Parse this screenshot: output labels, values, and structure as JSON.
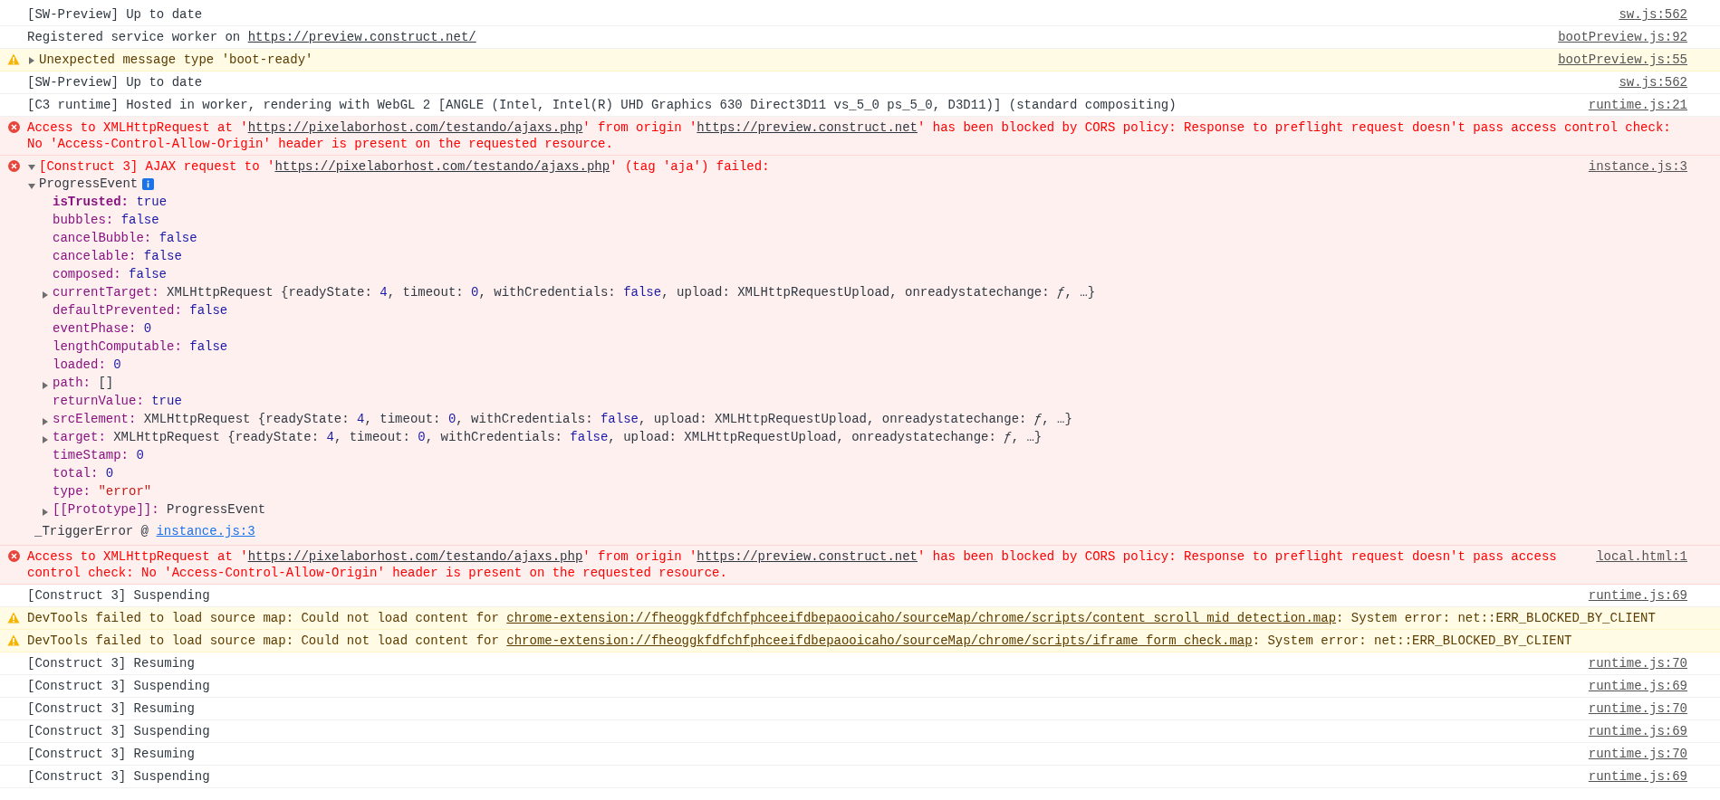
{
  "console": {
    "messages": [
      {
        "kind": "info",
        "parts": [
          {
            "text": "[SW-Preview] Up to date"
          }
        ],
        "source": "sw.js:562"
      },
      {
        "kind": "info",
        "parts": [
          {
            "text": "Registered service worker on "
          },
          {
            "link": "https://preview.construct.net/"
          }
        ],
        "source": "bootPreview.js:92"
      },
      {
        "kind": "warning",
        "expandable": true,
        "expanded": false,
        "parts": [
          {
            "text": "Unexpected message type 'boot-ready'"
          }
        ],
        "source": "bootPreview.js:55"
      },
      {
        "kind": "info",
        "parts": [
          {
            "text": "[SW-Preview] Up to date"
          }
        ],
        "source": "sw.js:562"
      },
      {
        "kind": "info",
        "parts": [
          {
            "text": "[C3 runtime] Hosted in worker, rendering with WebGL 2 [ANGLE (Intel, Intel(R) UHD Graphics 630 Direct3D11 vs_5_0 ps_5_0, D3D11)] (standard compositing)"
          }
        ],
        "source": "runtime.js:21"
      },
      {
        "kind": "error",
        "parts": [
          {
            "text": "Access to XMLHttpRequest at '"
          },
          {
            "link": "https://pixelaborhost.com/testando/ajaxs.php"
          },
          {
            "text": "' from origin '"
          },
          {
            "link": "https://preview.construct.net"
          },
          {
            "text": "' has been blocked by CORS policy: Response to preflight request doesn't pass access control check: No 'Access-Control-Allow-Origin' header is present on the requested resource."
          }
        ]
      },
      {
        "kind": "error",
        "expandable": true,
        "expanded": true,
        "parts": [
          {
            "text": "[Construct 3] AJAX request to '"
          },
          {
            "link": "https://pixelaborhost.com/testando/ajaxs.php"
          },
          {
            "text": "' (tag 'aja') failed:"
          }
        ],
        "source": "instance.js:3",
        "object": {
          "label": "ProgressEvent",
          "expanded": true,
          "properties": [
            {
              "key": "isTrusted: ",
              "own": true,
              "value": [
                {
                  "text": "true",
                  "kind": "literal"
                }
              ]
            },
            {
              "key": "bubbles: ",
              "value": [
                {
                  "text": "false",
                  "kind": "literal"
                }
              ]
            },
            {
              "key": "cancelBubble: ",
              "value": [
                {
                  "text": "false",
                  "kind": "literal"
                }
              ]
            },
            {
              "key": "cancelable: ",
              "value": [
                {
                  "text": "false",
                  "kind": "literal"
                }
              ]
            },
            {
              "key": "composed: ",
              "value": [
                {
                  "text": "false",
                  "kind": "literal"
                }
              ]
            },
            {
              "key": "currentTarget: ",
              "expandable": true,
              "expanded": false,
              "value": [
                {
                  "text": "XMLHttpRequest {readyState: ",
                  "kind": "plain"
                },
                {
                  "text": "4",
                  "kind": "literal"
                },
                {
                  "text": ", timeout: ",
                  "kind": "plain"
                },
                {
                  "text": "0",
                  "kind": "literal"
                },
                {
                  "text": ", withCredentials: ",
                  "kind": "plain"
                },
                {
                  "text": "false",
                  "kind": "literal"
                },
                {
                  "text": ", upload: XMLHttpRequestUpload, onreadystatechange: ",
                  "kind": "plain"
                },
                {
                  "text": "ƒ",
                  "kind": "function"
                },
                {
                  "text": ", …}",
                  "kind": "plain"
                }
              ]
            },
            {
              "key": "defaultPrevented: ",
              "value": [
                {
                  "text": "false",
                  "kind": "literal"
                }
              ]
            },
            {
              "key": "eventPhase: ",
              "value": [
                {
                  "text": "0",
                  "kind": "literal"
                }
              ]
            },
            {
              "key": "lengthComputable: ",
              "value": [
                {
                  "text": "false",
                  "kind": "literal"
                }
              ]
            },
            {
              "key": "loaded: ",
              "value": [
                {
                  "text": "0",
                  "kind": "literal"
                }
              ]
            },
            {
              "key": "path: ",
              "expandable": true,
              "expanded": false,
              "value": [
                {
                  "text": "[]",
                  "kind": "plain"
                }
              ]
            },
            {
              "key": "returnValue: ",
              "value": [
                {
                  "text": "true",
                  "kind": "literal"
                }
              ]
            },
            {
              "key": "srcElement: ",
              "expandable": true,
              "expanded": false,
              "value": [
                {
                  "text": "XMLHttpRequest {readyState: ",
                  "kind": "plain"
                },
                {
                  "text": "4",
                  "kind": "literal"
                },
                {
                  "text": ", timeout: ",
                  "kind": "plain"
                },
                {
                  "text": "0",
                  "kind": "literal"
                },
                {
                  "text": ", withCredentials: ",
                  "kind": "plain"
                },
                {
                  "text": "false",
                  "kind": "literal"
                },
                {
                  "text": ", upload: XMLHttpRequestUpload, onreadystatechange: ",
                  "kind": "plain"
                },
                {
                  "text": "ƒ",
                  "kind": "function"
                },
                {
                  "text": ", …}",
                  "kind": "plain"
                }
              ]
            },
            {
              "key": "target: ",
              "expandable": true,
              "expanded": false,
              "value": [
                {
                  "text": "XMLHttpRequest {readyState: ",
                  "kind": "plain"
                },
                {
                  "text": "4",
                  "kind": "literal"
                },
                {
                  "text": ", timeout: ",
                  "kind": "plain"
                },
                {
                  "text": "0",
                  "kind": "literal"
                },
                {
                  "text": ", withCredentials: ",
                  "kind": "plain"
                },
                {
                  "text": "false",
                  "kind": "literal"
                },
                {
                  "text": ", upload: XMLHttpRequestUpload, onreadystatechange: ",
                  "kind": "plain"
                },
                {
                  "text": "ƒ",
                  "kind": "function"
                },
                {
                  "text": ", …}",
                  "kind": "plain"
                }
              ]
            },
            {
              "key": "timeStamp: ",
              "value": [
                {
                  "text": "0",
                  "kind": "literal"
                }
              ]
            },
            {
              "key": "total: ",
              "value": [
                {
                  "text": "0",
                  "kind": "literal"
                }
              ]
            },
            {
              "key": "type: ",
              "value": [
                {
                  "text": "\"error\"",
                  "kind": "string"
                }
              ]
            },
            {
              "key": "[[Prototype]]: ",
              "expandable": true,
              "expanded": false,
              "value": [
                {
                  "text": "ProgressEvent",
                  "kind": "plain"
                }
              ]
            }
          ]
        },
        "stack": {
          "text": "_TriggerError @ ",
          "link": "instance.js:3"
        }
      },
      {
        "kind": "error",
        "parts": [
          {
            "text": "Access to XMLHttpRequest at '"
          },
          {
            "link": "https://pixelaborhost.com/testando/ajaxs.php"
          },
          {
            "text": "' from origin '"
          },
          {
            "link": "https://preview.construct.net"
          },
          {
            "text": "' has been blocked by CORS policy: Response to preflight request doesn't pass access control check: No 'Access-Control-Allow-Origin' header is present on the requested resource."
          }
        ],
        "source": "local.html:1"
      },
      {
        "kind": "info",
        "parts": [
          {
            "text": "[Construct 3] Suspending"
          }
        ],
        "source": "runtime.js:69"
      },
      {
        "kind": "warning",
        "parts": [
          {
            "text": "DevTools failed to load source map: Could not load content for "
          },
          {
            "link": "chrome-extension://fheoggkfdfchfphceeifdbepaooicaho/sourceMap/chrome/scripts/content_scroll_mid_detection.map"
          },
          {
            "text": ": System error: net::ERR_BLOCKED_BY_CLIENT"
          }
        ]
      },
      {
        "kind": "warning",
        "parts": [
          {
            "text": "DevTools failed to load source map: Could not load content for "
          },
          {
            "link": "chrome-extension://fheoggkfdfchfphceeifdbepaooicaho/sourceMap/chrome/scripts/iframe_form_check.map"
          },
          {
            "text": ": System error: net::ERR_BLOCKED_BY_CLIENT"
          }
        ]
      },
      {
        "kind": "info",
        "parts": [
          {
            "text": "[Construct 3] Resuming"
          }
        ],
        "source": "runtime.js:70"
      },
      {
        "kind": "info",
        "parts": [
          {
            "text": "[Construct 3] Suspending"
          }
        ],
        "source": "runtime.js:69"
      },
      {
        "kind": "info",
        "parts": [
          {
            "text": "[Construct 3] Resuming"
          }
        ],
        "source": "runtime.js:70"
      },
      {
        "kind": "info",
        "parts": [
          {
            "text": "[Construct 3] Suspending"
          }
        ],
        "source": "runtime.js:69"
      },
      {
        "kind": "info",
        "parts": [
          {
            "text": "[Construct 3] Resuming"
          }
        ],
        "source": "runtime.js:70"
      },
      {
        "kind": "info",
        "parts": [
          {
            "text": "[Construct 3] Suspending"
          }
        ],
        "source": "runtime.js:69"
      }
    ]
  }
}
